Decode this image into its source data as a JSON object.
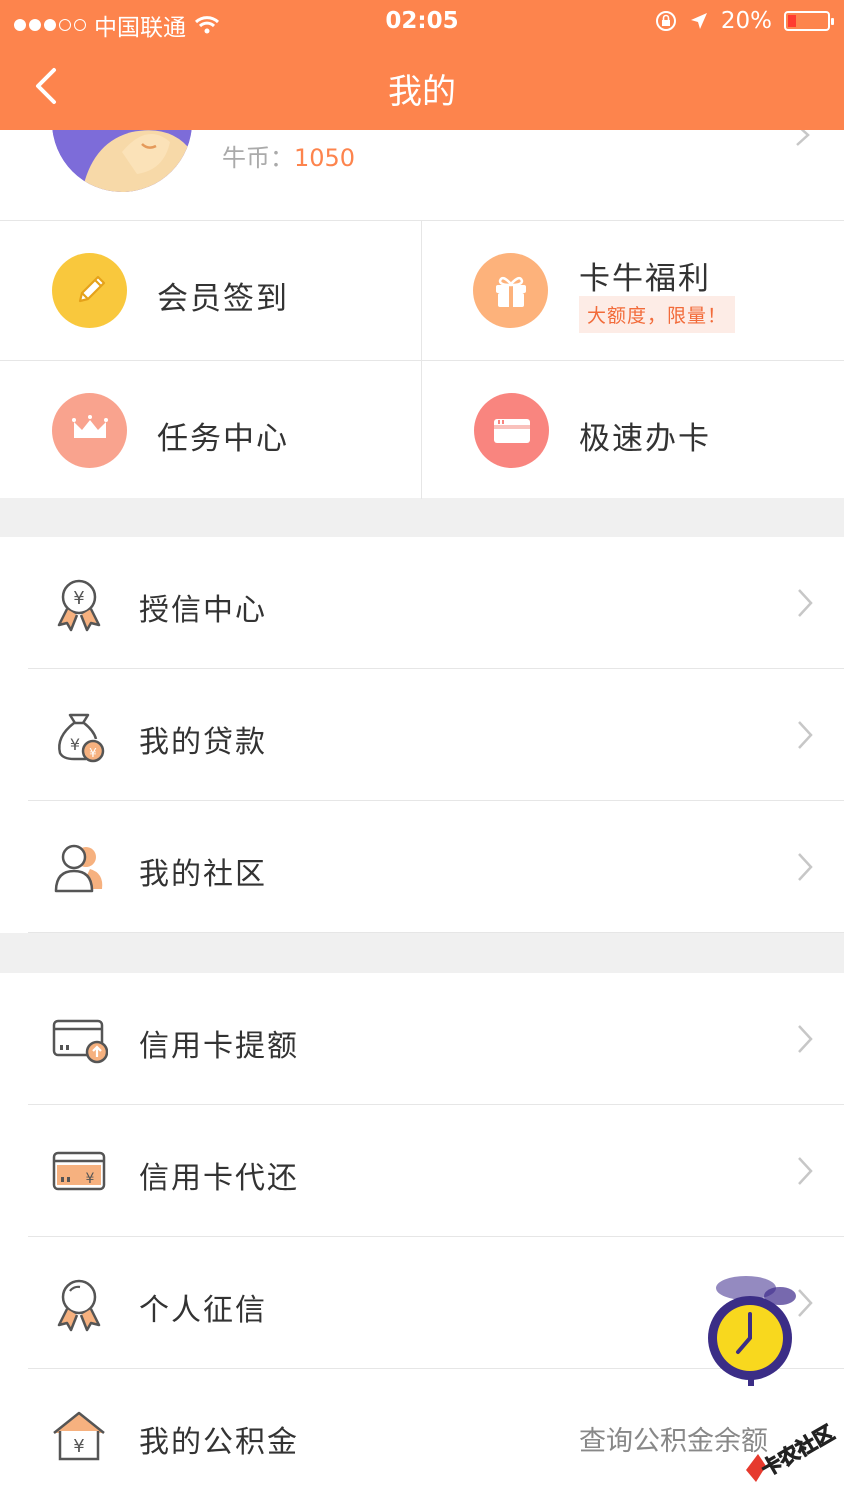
{
  "status": {
    "carrier": "中国联通",
    "time": "02:05",
    "battery": "20%"
  },
  "nav": {
    "title": "我的"
  },
  "profile": {
    "coins_label": "牛币：",
    "coins_value": "1050"
  },
  "grid": {
    "checkin": "会员签到",
    "welfare": "卡牛福利",
    "welfare_badge": "大额度，限量！",
    "tasks": "任务中心",
    "card_apply": "极速办卡"
  },
  "section1": [
    {
      "label": "授信中心"
    },
    {
      "label": "我的贷款"
    },
    {
      "label": "我的社区"
    }
  ],
  "section2": [
    {
      "label": "信用卡提额"
    },
    {
      "label": "信用卡代还"
    },
    {
      "label": "个人征信"
    },
    {
      "label": "我的公积金",
      "note": "查询公积金余额"
    }
  ],
  "watermark": {
    "text": "卡农社区"
  },
  "colors": {
    "accent": "#fd844d",
    "yellow": "#f9c83d",
    "peach": "#fdb27b",
    "salmon": "#f9a38e",
    "alarm": "#f8d81e"
  }
}
